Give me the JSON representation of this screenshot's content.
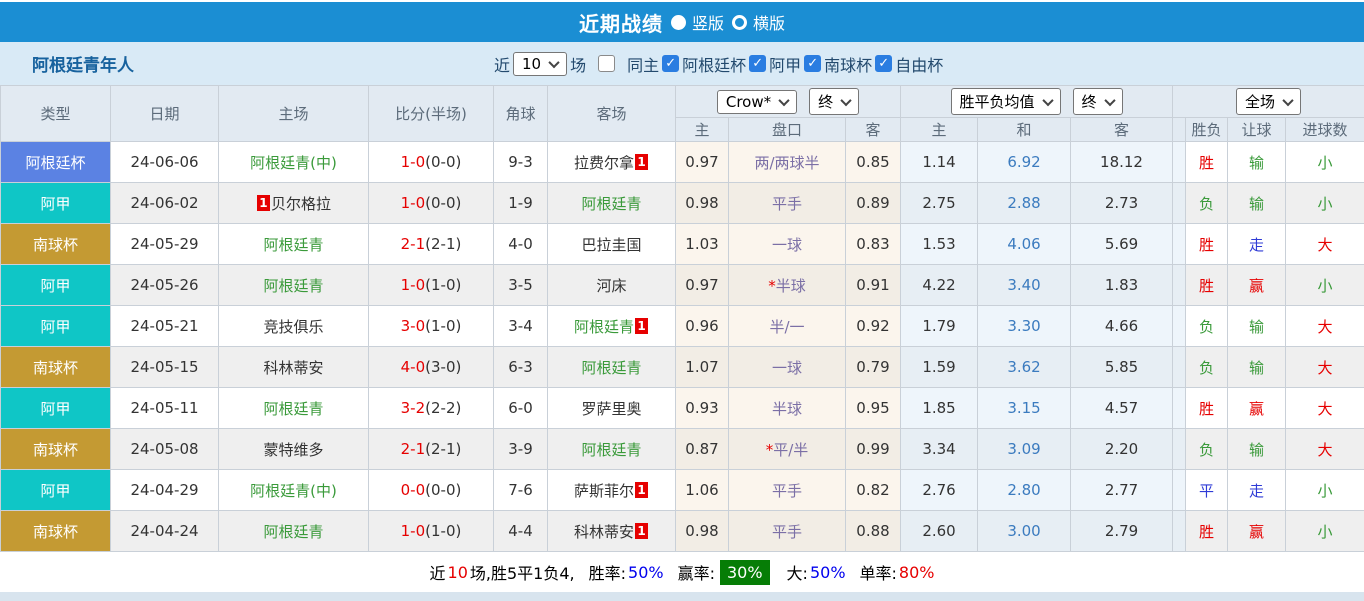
{
  "titlebar": {
    "title": "近期战绩",
    "radio_vertical_label": "竖版",
    "radio_horizontal_label": "横版",
    "bar_color": "#1b8ed3"
  },
  "filterbar": {
    "team_name": "阿根廷青年人",
    "near_label": "近",
    "match_count": "10",
    "matches_label": "场",
    "same_venue_label": "同主",
    "leagues": [
      {
        "label": "阿根廷杯",
        "checked": true
      },
      {
        "label": "阿甲",
        "checked": true
      },
      {
        "label": "南球杯",
        "checked": true
      },
      {
        "label": "自由杯",
        "checked": true
      }
    ]
  },
  "table": {
    "headers": {
      "type": "类型",
      "date": "日期",
      "home": "主场",
      "score": "比分(半场)",
      "corner": "角球",
      "away": "客场"
    },
    "dropdowns": {
      "odds_company": "Crow*",
      "odds_time": "终",
      "avg_label": "胜平负均值",
      "avg_time": "终",
      "scope": "全场"
    },
    "subheaders": {
      "crow_home": "主",
      "handicap": "盘口",
      "crow_away": "客",
      "avg_home": "主",
      "avg_draw": "和",
      "avg_away": "客",
      "result": "胜负",
      "handicap_result": "让球",
      "goals": "进球数"
    },
    "league_colors": {
      "argentina_cup": "#5b82e3",
      "primera": "#0fc6c6",
      "sudamericana": "#c49a33"
    },
    "rows": [
      {
        "league": "阿根廷杯",
        "league_color": "#5b82e3",
        "date": "24-06-06",
        "home": "阿根廷青(中)",
        "home_color": "green",
        "home_card": "",
        "score": "1-0",
        "half": "(0-0)",
        "corner": "9-3",
        "away": "拉费尔拿",
        "away_color": "dark",
        "away_card": "1",
        "crow_home": "0.97",
        "handicap_star": "",
        "handicap": "两/两球半",
        "crow_away": "0.85",
        "avg_home": "1.14",
        "avg_draw": "6.92",
        "avg_away": "18.12",
        "result": "胜",
        "result_color": "red",
        "handicap_result": "输",
        "handicap_result_color": "green",
        "goals": "小",
        "goals_color": "green"
      },
      {
        "league": "阿甲",
        "league_color": "#0fc6c6",
        "date": "24-06-02",
        "home": "贝尔格拉",
        "home_color": "dark",
        "home_card": "1",
        "score": "1-0",
        "half": "(0-0)",
        "corner": "1-9",
        "away": "阿根廷青",
        "away_color": "green",
        "away_card": "",
        "crow_home": "0.98",
        "handicap_star": "",
        "handicap": "平手",
        "crow_away": "0.89",
        "avg_home": "2.75",
        "avg_draw": "2.88",
        "avg_away": "2.73",
        "result": "负",
        "result_color": "green",
        "handicap_result": "输",
        "handicap_result_color": "green",
        "goals": "小",
        "goals_color": "green"
      },
      {
        "league": "南球杯",
        "league_color": "#c49a33",
        "date": "24-05-29",
        "home": "阿根廷青",
        "home_color": "green",
        "home_card": "",
        "score": "2-1",
        "half": "(2-1)",
        "corner": "4-0",
        "away": "巴拉圭国",
        "away_color": "dark",
        "away_card": "",
        "crow_home": "1.03",
        "handicap_star": "",
        "handicap": "一球",
        "crow_away": "0.83",
        "avg_home": "1.53",
        "avg_draw": "4.06",
        "avg_away": "5.69",
        "result": "胜",
        "result_color": "red",
        "handicap_result": "走",
        "handicap_result_color": "blue",
        "goals": "大",
        "goals_color": "red"
      },
      {
        "league": "阿甲",
        "league_color": "#0fc6c6",
        "date": "24-05-26",
        "home": "阿根廷青",
        "home_color": "green",
        "home_card": "",
        "score": "1-0",
        "half": "(1-0)",
        "corner": "3-5",
        "away": "河床",
        "away_color": "dark",
        "away_card": "",
        "crow_home": "0.97",
        "handicap_star": "*",
        "handicap": "半球",
        "crow_away": "0.91",
        "avg_home": "4.22",
        "avg_draw": "3.40",
        "avg_away": "1.83",
        "result": "胜",
        "result_color": "red",
        "handicap_result": "赢",
        "handicap_result_color": "red",
        "goals": "小",
        "goals_color": "green"
      },
      {
        "league": "阿甲",
        "league_color": "#0fc6c6",
        "date": "24-05-21",
        "home": "竞技俱乐",
        "home_color": "dark",
        "home_card": "",
        "score": "3-0",
        "half": "(1-0)",
        "corner": "3-4",
        "away": "阿根廷青",
        "away_color": "green",
        "away_card": "1",
        "crow_home": "0.96",
        "handicap_star": "",
        "handicap": "半/一",
        "crow_away": "0.92",
        "avg_home": "1.79",
        "avg_draw": "3.30",
        "avg_away": "4.66",
        "result": "负",
        "result_color": "green",
        "handicap_result": "输",
        "handicap_result_color": "green",
        "goals": "大",
        "goals_color": "red"
      },
      {
        "league": "南球杯",
        "league_color": "#c49a33",
        "date": "24-05-15",
        "home": "科林蒂安",
        "home_color": "dark",
        "home_card": "",
        "score": "4-0",
        "half": "(3-0)",
        "corner": "6-3",
        "away": "阿根廷青",
        "away_color": "green",
        "away_card": "",
        "crow_home": "1.07",
        "handicap_star": "",
        "handicap": "一球",
        "crow_away": "0.79",
        "avg_home": "1.59",
        "avg_draw": "3.62",
        "avg_away": "5.85",
        "result": "负",
        "result_color": "green",
        "handicap_result": "输",
        "handicap_result_color": "green",
        "goals": "大",
        "goals_color": "red"
      },
      {
        "league": "阿甲",
        "league_color": "#0fc6c6",
        "date": "24-05-11",
        "home": "阿根廷青",
        "home_color": "green",
        "home_card": "",
        "score": "3-2",
        "half": "(2-2)",
        "corner": "6-0",
        "away": "罗萨里奥",
        "away_color": "dark",
        "away_card": "",
        "crow_home": "0.93",
        "handicap_star": "",
        "handicap": "半球",
        "crow_away": "0.95",
        "avg_home": "1.85",
        "avg_draw": "3.15",
        "avg_away": "4.57",
        "result": "胜",
        "result_color": "red",
        "handicap_result": "赢",
        "handicap_result_color": "red",
        "goals": "大",
        "goals_color": "red"
      },
      {
        "league": "南球杯",
        "league_color": "#c49a33",
        "date": "24-05-08",
        "home": "蒙特维多",
        "home_color": "dark",
        "home_card": "",
        "score": "2-1",
        "half": "(2-1)",
        "corner": "3-9",
        "away": "阿根廷青",
        "away_color": "green",
        "away_card": "",
        "crow_home": "0.87",
        "handicap_star": "*",
        "handicap": "平/半",
        "crow_away": "0.99",
        "avg_home": "3.34",
        "avg_draw": "3.09",
        "avg_away": "2.20",
        "result": "负",
        "result_color": "green",
        "handicap_result": "输",
        "handicap_result_color": "green",
        "goals": "大",
        "goals_color": "red"
      },
      {
        "league": "阿甲",
        "league_color": "#0fc6c6",
        "date": "24-04-29",
        "home": "阿根廷青(中)",
        "home_color": "green",
        "home_card": "",
        "score": "0-0",
        "half": "(0-0)",
        "corner": "7-6",
        "away": "萨斯菲尔",
        "away_color": "dark",
        "away_card": "1",
        "crow_home": "1.06",
        "handicap_star": "",
        "handicap": "平手",
        "crow_away": "0.82",
        "avg_home": "2.76",
        "avg_draw": "2.80",
        "avg_away": "2.77",
        "result": "平",
        "result_color": "blue",
        "handicap_result": "走",
        "handicap_result_color": "blue",
        "goals": "小",
        "goals_color": "green"
      },
      {
        "league": "南球杯",
        "league_color": "#c49a33",
        "date": "24-04-24",
        "home": "阿根廷青",
        "home_color": "green",
        "home_card": "",
        "score": "1-0",
        "half": "(1-0)",
        "corner": "4-4",
        "away": "科林蒂安",
        "away_color": "dark",
        "away_card": "1",
        "crow_home": "0.98",
        "handicap_star": "",
        "handicap": "平手",
        "crow_away": "0.88",
        "avg_home": "2.60",
        "avg_draw": "3.00",
        "avg_away": "2.79",
        "result": "胜",
        "result_color": "red",
        "handicap_result": "赢",
        "handicap_result_color": "red",
        "goals": "小",
        "goals_color": "green"
      }
    ]
  },
  "footer": {
    "near_label": "近",
    "count": "10",
    "record_text": "场,胜5平1负4,",
    "win_rate_label": "胜率:",
    "win_rate": "50%",
    "profit_rate_label": "赢率:",
    "profit_rate": "30%",
    "profit_badge_color": "#067d06",
    "big_rate_label": "大:",
    "big_rate": "50%",
    "single_rate_label": "单率:",
    "single_rate": "80%"
  }
}
